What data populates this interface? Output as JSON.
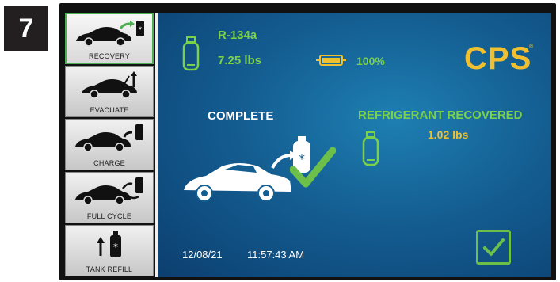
{
  "step_number": "7",
  "sidebar": {
    "items": [
      {
        "label": "RECOVERY",
        "active": true
      },
      {
        "label": "EVACUATE",
        "active": false
      },
      {
        "label": "CHARGE",
        "active": false
      },
      {
        "label": "FULL CYCLE",
        "active": false
      },
      {
        "label": "TANK REFILL",
        "active": false
      }
    ]
  },
  "tank": {
    "refrigerant": "R-134a",
    "weight": "7.25 lbs"
  },
  "battery": {
    "percent": "100%",
    "level": 1.0
  },
  "brand": {
    "logo": "CPS"
  },
  "status": {
    "complete_label": "COMPLETE"
  },
  "recovered": {
    "title": "REFRIGERANT RECOVERED",
    "amount": "1.02 lbs"
  },
  "footer": {
    "date": "12/08/21",
    "time": "11:57:43 AM"
  },
  "colors": {
    "accent_green": "#7bd14a",
    "brand_yellow": "#f0c030",
    "screen_blue": "#145e92"
  },
  "icons": [
    "tank-icon",
    "battery-icon",
    "car-icon",
    "checkmark-icon",
    "confirm-checkbox-icon"
  ]
}
